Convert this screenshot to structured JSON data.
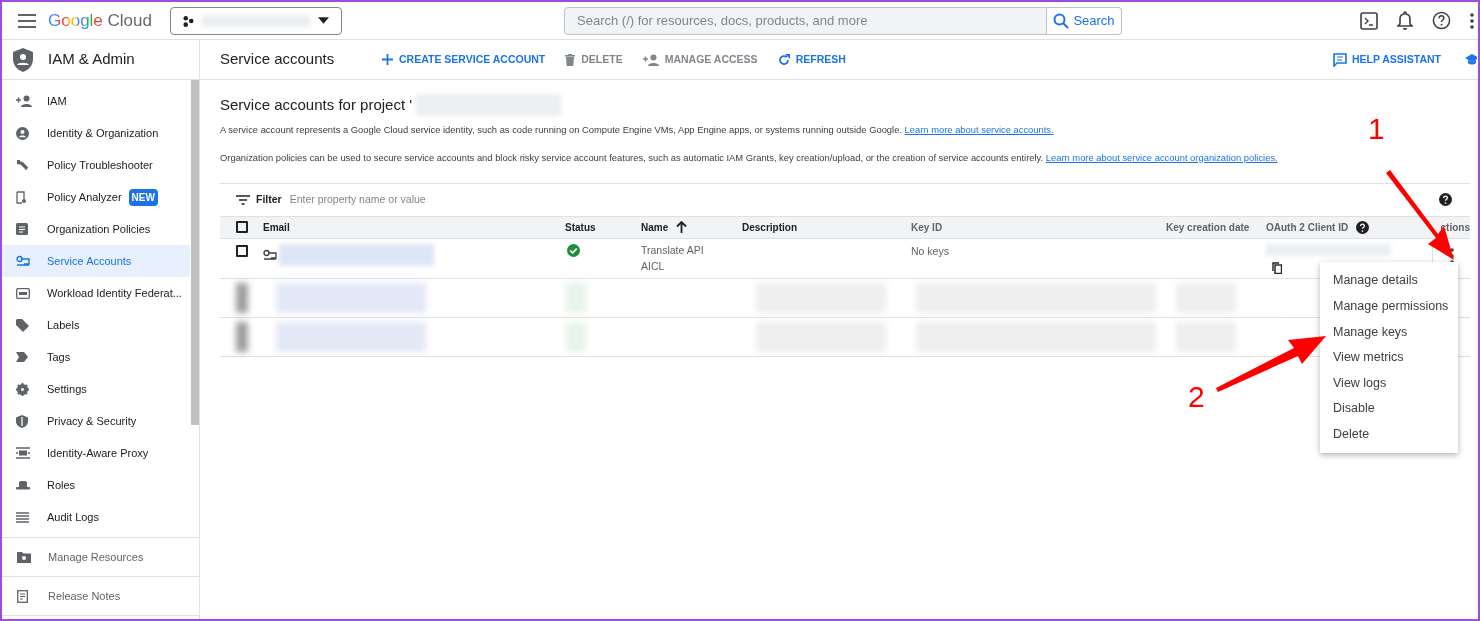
{
  "topbar": {
    "logo": "Google Cloud",
    "search": {
      "placeholder": "Search (/) for resources, docs, products, and more",
      "button": "Search"
    }
  },
  "sidebar": {
    "title": "IAM & Admin",
    "items": [
      {
        "label": "IAM",
        "selected": false
      },
      {
        "label": "Identity & Organization",
        "selected": false
      },
      {
        "label": "Policy Troubleshooter",
        "selected": false
      },
      {
        "label": "Policy Analyzer",
        "badge": "NEW",
        "selected": false
      },
      {
        "label": "Organization Policies",
        "selected": false
      },
      {
        "label": "Service Accounts",
        "selected": true
      },
      {
        "label": "Workload Identity Federat...",
        "selected": false
      },
      {
        "label": "Labels",
        "selected": false
      },
      {
        "label": "Tags",
        "selected": false
      },
      {
        "label": "Settings",
        "selected": false
      },
      {
        "label": "Privacy & Security",
        "selected": false
      },
      {
        "label": "Identity-Aware Proxy",
        "selected": false
      },
      {
        "label": "Roles",
        "selected": false
      },
      {
        "label": "Audit Logs",
        "selected": false
      }
    ],
    "footer_items": [
      "Manage Resources",
      "Release Notes"
    ]
  },
  "toolbar": {
    "title": "Service accounts",
    "actions": [
      {
        "label": "CREATE SERVICE ACCOUNT",
        "disabled": false
      },
      {
        "label": "DELETE",
        "disabled": true
      },
      {
        "label": "MANAGE ACCESS",
        "disabled": true
      },
      {
        "label": "REFRESH",
        "disabled": false
      }
    ],
    "help": "HELP ASSISTANT"
  },
  "page": {
    "heading": "Service accounts for project '",
    "paragraphs": [
      {
        "text": "A service account represents a Google Cloud service identity, such as code running on Compute Engine VMs, App Engine apps, or systems running outside Google.",
        "link": "Learn more about service accounts."
      },
      {
        "text": "Organization policies can be used to secure service accounts and block risky service account features, such as automatic IAM Grants, key creation/upload, or the creation of service accounts entirely.",
        "link": "Learn more about service account organization policies."
      }
    ]
  },
  "table": {
    "filter_label": "Filter",
    "filter_placeholder": "Enter property name or value",
    "columns": [
      "Email",
      "Status",
      "Name",
      "Description",
      "Key ID",
      "Key creation date",
      "OAuth 2 Client ID",
      "ctions"
    ],
    "header_checked": false,
    "rows": [
      {
        "checked": false,
        "enabled": true,
        "name": "Translate API AICL",
        "key_id": "No keys"
      }
    ],
    "redacted_rows": [
      {
        "kind": "redacted"
      },
      {
        "kind": "redacted"
      }
    ]
  },
  "menu": {
    "items": [
      "Manage details",
      "Manage permissions",
      "Manage keys",
      "View metrics",
      "View logs",
      "Disable",
      "Delete"
    ]
  },
  "annotations": [
    {
      "label": "1"
    },
    {
      "label": "2"
    }
  ]
}
